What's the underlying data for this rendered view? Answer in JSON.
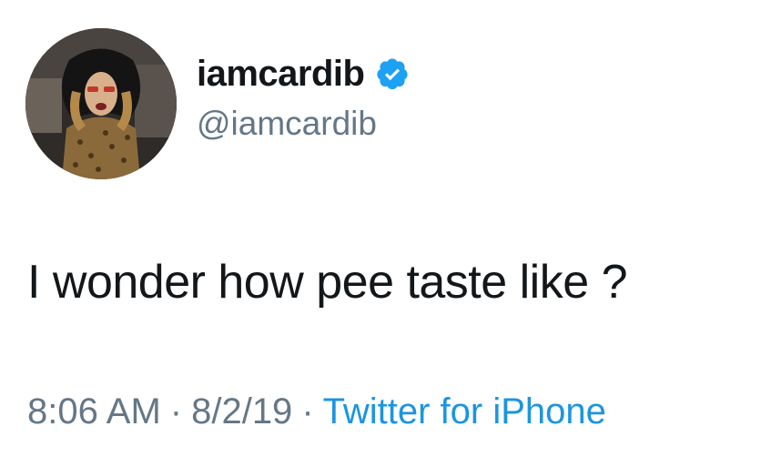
{
  "user": {
    "display_name": "iamcardib",
    "handle": "@iamcardib",
    "verified": true
  },
  "tweet": {
    "text": "I wonder how pee taste like ?",
    "time": "8:06 AM",
    "separator": "·",
    "date": "8/2/19",
    "source": "Twitter for iPhone"
  },
  "colors": {
    "text_primary": "#14171a",
    "text_secondary": "#657786",
    "link": "#1b95e0",
    "verified_badge": "#1da1f2"
  },
  "icons": {
    "verified": "verified-badge-icon",
    "avatar": "profile-avatar-photo"
  }
}
